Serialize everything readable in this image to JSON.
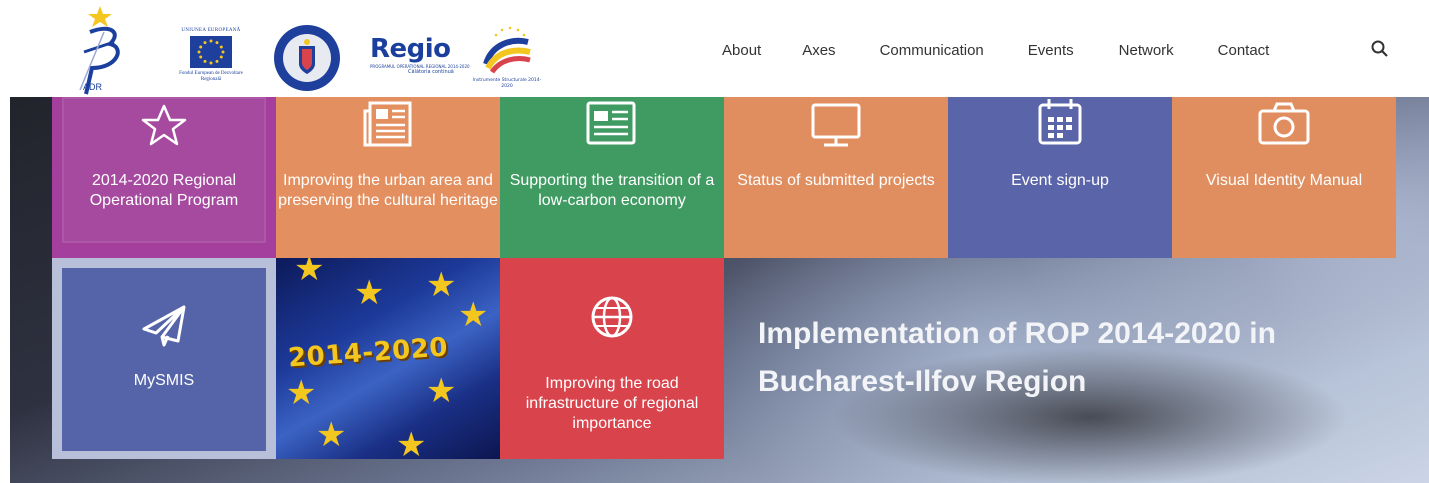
{
  "header": {
    "logos": {
      "adr": "ADR",
      "eu_top": "UNIUNEA EUROPEANĂ",
      "eu_bottom": "Fondul European de Dezvoltare Regională",
      "regio": "Regio",
      "regio_sub": "PROGRAMUL OPERAȚIONAL REGIONAL 2014-2020",
      "regio_tag": "Călătoria continuă",
      "instrumente": "Instrumente Structurale 2014-2020"
    },
    "nav": [
      {
        "label": "About"
      },
      {
        "label": "Axes"
      },
      {
        "label": "Communication"
      },
      {
        "label": "Events"
      },
      {
        "label": "Network"
      },
      {
        "label": "Contact"
      }
    ],
    "search_icon": "search-icon"
  },
  "tiles": [
    {
      "label": "2014-2020 Regional Operational Program",
      "icon": "star-icon",
      "color": "#a43f9e"
    },
    {
      "label": "Improving the urban area and preserving the cultural heritage",
      "icon": "newspaper-icon",
      "color": "#e48f5f"
    },
    {
      "label": "Supporting the transition of a low-carbon economy",
      "icon": "document-icon",
      "color": "#3f9b62"
    },
    {
      "label": "Status of submitted projects",
      "icon": "monitor-icon",
      "color": "#e08e5f"
    },
    {
      "label": "Event sign-up",
      "icon": "calendar-icon",
      "color": "#5a64a8"
    },
    {
      "label": "Visual Identity Manual",
      "icon": "camera-icon",
      "color": "#e08e5f"
    },
    {
      "label": "MySMIS",
      "icon": "paper-plane-icon",
      "color": "#5564a8"
    },
    {
      "label": "2014-2020",
      "icon": "eu-flag-image"
    },
    {
      "label": "Improving the road infrastructure of regional importance",
      "icon": "globe-icon",
      "color": "#d9434b"
    }
  ],
  "hero": {
    "title": "Implementation of ROP 2014-2020 in Bucharest-Ilfov Region"
  }
}
